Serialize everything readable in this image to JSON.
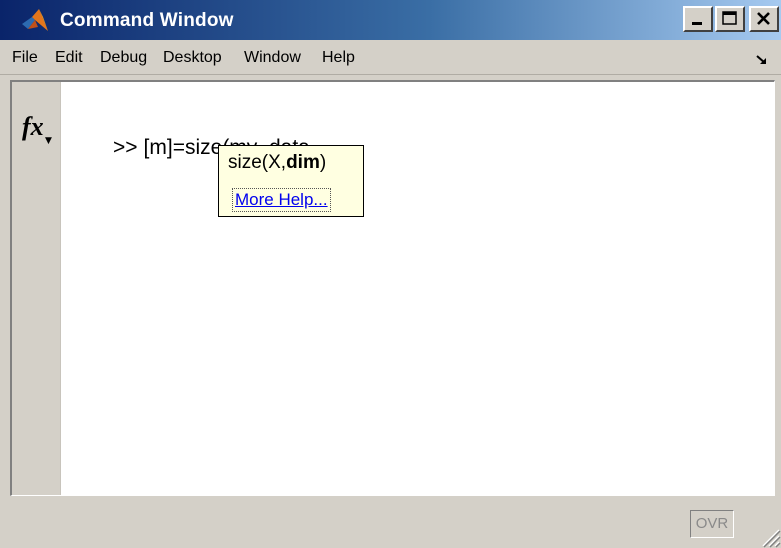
{
  "window": {
    "title": "Command Window",
    "icon": "matlab-logo-icon",
    "controls": [
      "minimize-icon",
      "maximize-icon",
      "close-icon"
    ]
  },
  "menubar": {
    "items": [
      "File",
      "Edit",
      "Debug",
      "Desktop",
      "Window",
      "Help"
    ],
    "extra_icon": "undock-arrow-icon"
  },
  "command": {
    "fx_icon": "fx-function-browser-icon",
    "prompt": ">>",
    "input": "[m]=size(my_data,"
  },
  "tooltip": {
    "signature_prefix": "size(X,",
    "signature_bold": "dim",
    "signature_suffix": ")",
    "link": "More Help..."
  },
  "statusbar": {
    "ovr": "OVR",
    "grip_icon": "resize-grip-icon"
  },
  "colors": {
    "title_gradient_start": "#0a246a",
    "title_gradient_end": "#a6caf0",
    "tooltip_bg": "#ffffe1",
    "link": "#0000ee",
    "chrome": "#d4d0c8"
  }
}
